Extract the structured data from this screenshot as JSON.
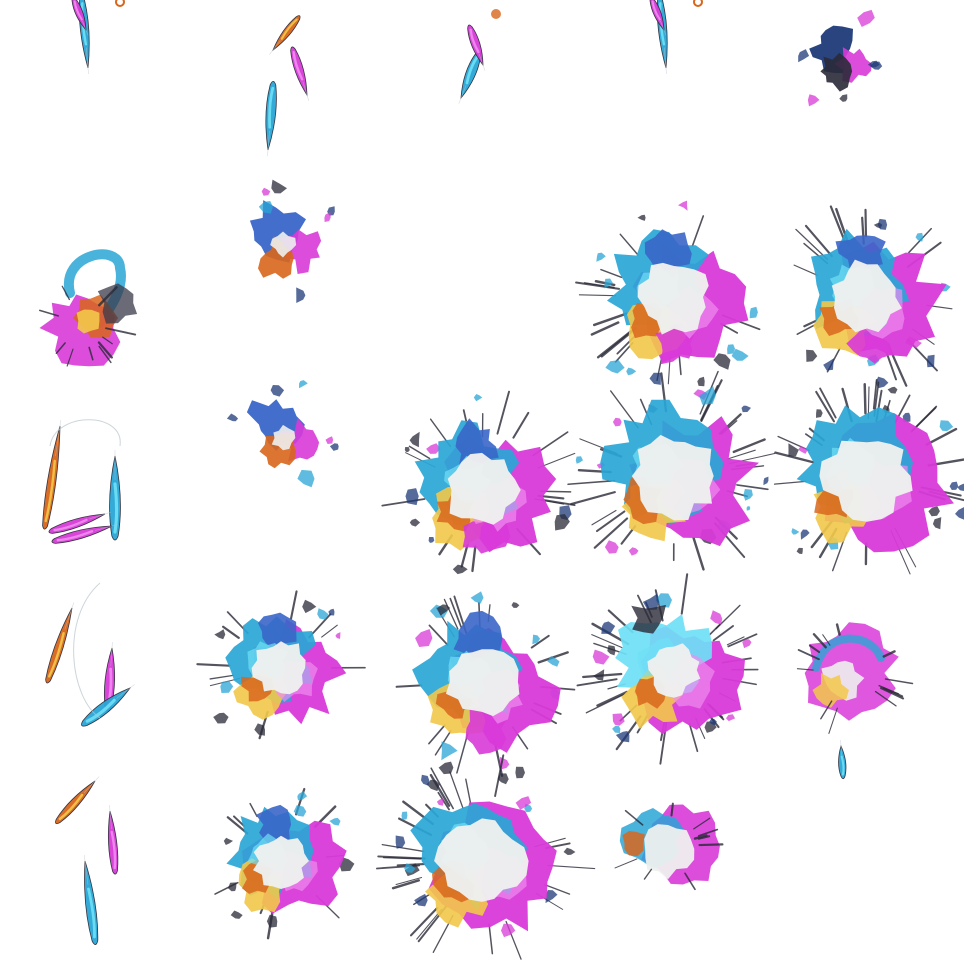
{
  "sprite_sheet": {
    "columns": 5,
    "rows": 5,
    "background": "#ffffff",
    "palette": {
      "cyan": "#2aa6d6",
      "cyan_light": "#6fe0f5",
      "magenta": "#d83ad8",
      "magenta_light": "#f08cf0",
      "orange": "#d8661c",
      "gold": "#f2c84a",
      "navy": "#1e3a78",
      "blue": "#3a66c8",
      "core": "#eef0ee",
      "dark": "#2a2a38"
    },
    "frames": [
      {
        "kind": "streak_top"
      },
      {
        "kind": "streaks_launch"
      },
      {
        "kind": "streaks_pair"
      },
      {
        "kind": "streak_top"
      },
      {
        "kind": "burst_small_dark"
      },
      {
        "kind": "swirl"
      },
      {
        "kind": "burst_small_blue"
      },
      {
        "kind": "empty"
      },
      {
        "kind": "burst_large"
      },
      {
        "kind": "burst_large"
      },
      {
        "kind": "streaks_ring"
      },
      {
        "kind": "burst_small_blue"
      },
      {
        "kind": "burst_large"
      },
      {
        "kind": "burst_wide"
      },
      {
        "kind": "burst_wide"
      },
      {
        "kind": "streaks_fall"
      },
      {
        "kind": "burst_medium"
      },
      {
        "kind": "burst_large"
      },
      {
        "kind": "burst_dark_spiky"
      },
      {
        "kind": "burst_fade"
      },
      {
        "kind": "streaks_three"
      },
      {
        "kind": "burst_medium"
      },
      {
        "kind": "burst_wide"
      },
      {
        "kind": "burst_faded_small"
      },
      {
        "kind": "empty"
      }
    ]
  }
}
